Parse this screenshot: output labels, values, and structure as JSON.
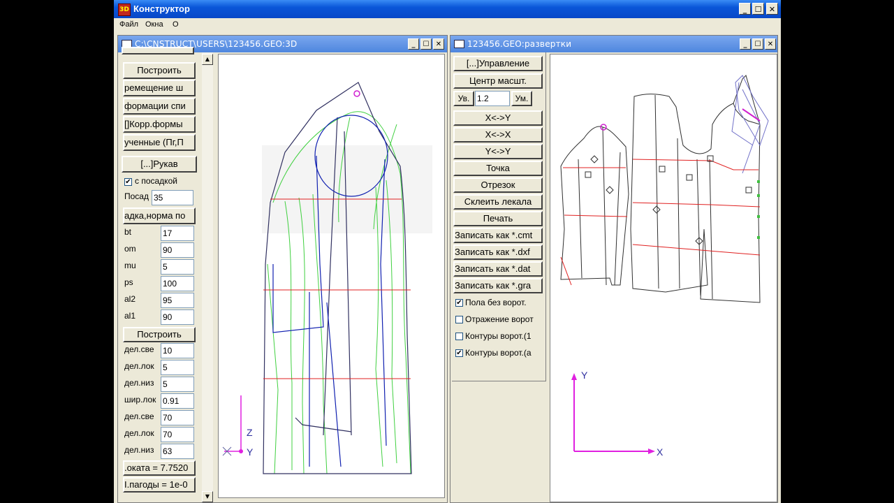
{
  "app": {
    "title": "Конструктор",
    "icon_text": "3D",
    "window_buttons": [
      "_",
      "☐",
      "✕"
    ]
  },
  "menubar": [
    "Файл",
    "Окна",
    "О"
  ],
  "left_window": {
    "title": "C:\\CNSTRUCT\\USERS\\123456.GEO:3D",
    "buttons": [
      "Построить",
      "ремещение ш",
      "формации спи",
      "[]Корр.формы",
      "ученные (Пг,П"
    ],
    "section_title": "[...]Рукав",
    "checkbox_posadka": {
      "label": "с посадкой",
      "checked": true
    },
    "posadka": {
      "label": "Посад",
      "value": "35"
    },
    "norm_button": "адка,норма по",
    "params": [
      {
        "label": "bt",
        "value": "17"
      },
      {
        "label": "om",
        "value": "90"
      },
      {
        "label": "mu",
        "value": "5"
      },
      {
        "label": "ps",
        "value": "100"
      },
      {
        "label": "al2",
        "value": "95"
      },
      {
        "label": "al1",
        "value": "90"
      }
    ],
    "build_button": "Построить",
    "params2": [
      {
        "label": "дел.све",
        "value": "10"
      },
      {
        "label": "дел.лок",
        "value": "5"
      },
      {
        "label": "дел.низ",
        "value": "5"
      },
      {
        "label": "шир.лок",
        "value": "0.91"
      },
      {
        "label": "дел.све",
        "value": "70"
      },
      {
        "label": "дел.лок",
        "value": "70"
      },
      {
        "label": "дел.низ",
        "value": "63"
      }
    ],
    "info": [
      ".оката = 7.7520",
      "I.пагоды = 1e-0"
    ],
    "axes": {
      "z": "Z",
      "y": "Y"
    }
  },
  "right_window": {
    "title": "123456.GEO:развертки",
    "control_button": "[...]Управление",
    "center_button": "Центр масшт.",
    "zoom_in": "Ув.",
    "zoom_value": "1.2",
    "zoom_out": "Ум.",
    "buttons": [
      "X<->Y",
      "X<->X",
      "Y<->Y",
      "Точка",
      "Отрезок",
      "Склеить лекала",
      "Печать",
      "Записать как *.cmt",
      "Записать как *.dxf",
      "Записать как *.dat",
      "Записать как *.gra"
    ],
    "checkboxes": [
      {
        "label": "Пола без ворот.",
        "checked": true
      },
      {
        "label": "Отражение ворот",
        "checked": false
      },
      {
        "label": "Контуры ворот.(1",
        "checked": false
      },
      {
        "label": "Контуры ворот.(а",
        "checked": true
      }
    ],
    "axes": {
      "x": "X",
      "y": "Y"
    }
  },
  "colors": {
    "title_blue": "#0a56d8",
    "child_title": "#6a9be8",
    "axis_magenta": "#e020e0",
    "line_red": "#e02020",
    "line_green": "#40d040",
    "line_blue": "#1020a0"
  }
}
